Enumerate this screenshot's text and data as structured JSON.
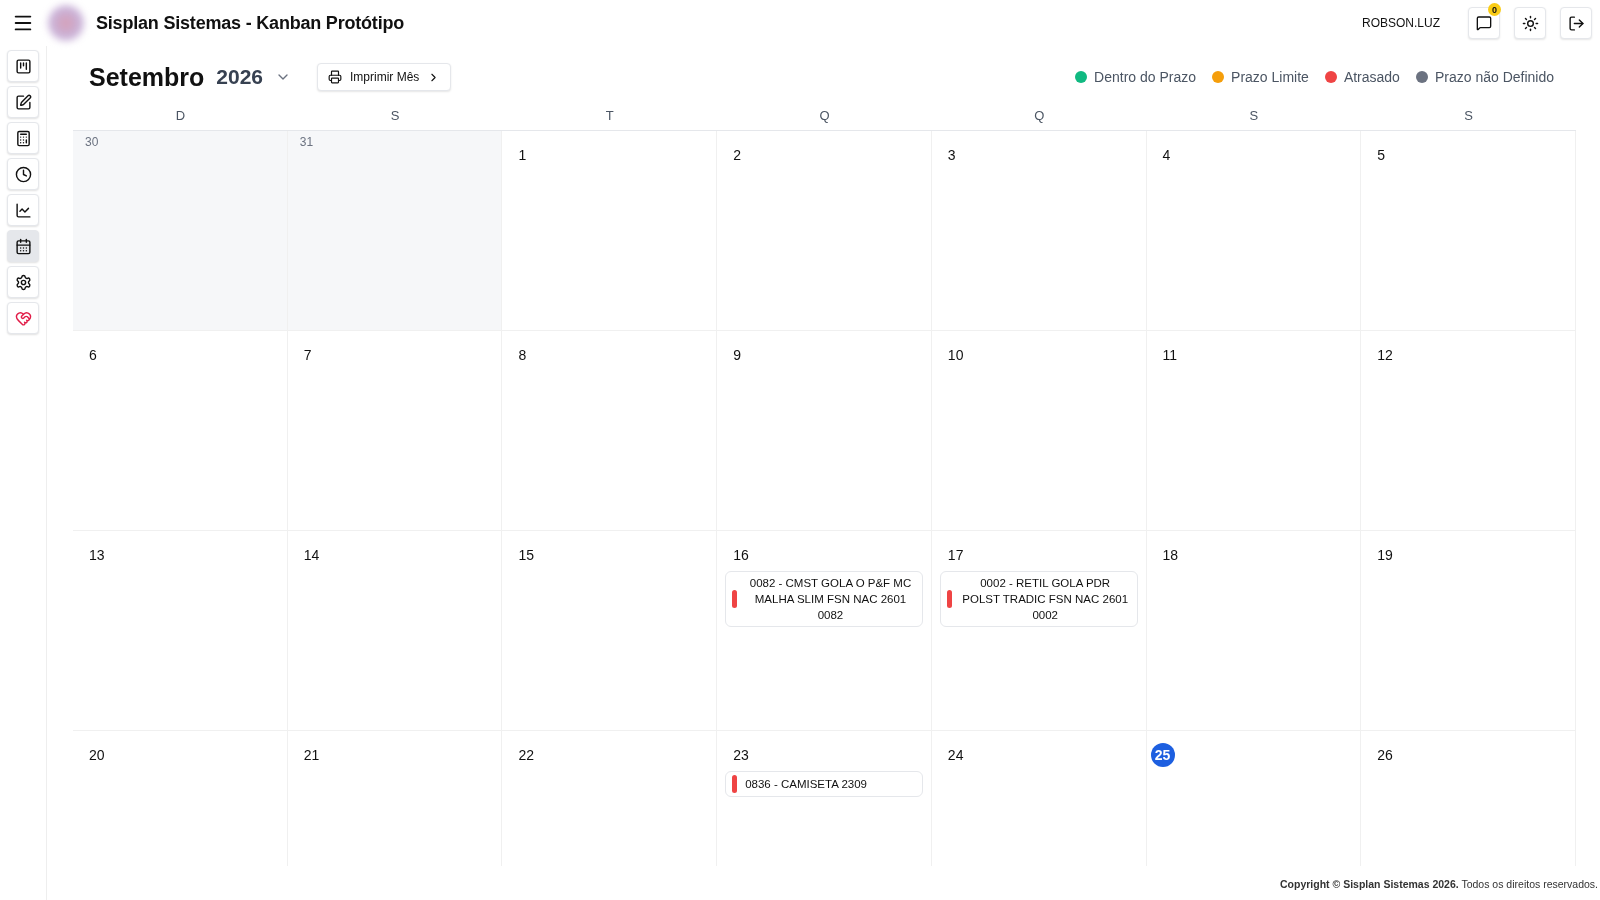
{
  "header": {
    "title": "Sisplan Sistemas - Kanban Protótipo",
    "user": "ROBSON.LUZ",
    "notification_count": "0"
  },
  "sidebar": {
    "items": [
      {
        "kind": "kanban",
        "selected": false
      },
      {
        "kind": "edit",
        "selected": false
      },
      {
        "kind": "calculator",
        "selected": false
      },
      {
        "kind": "clock",
        "selected": false
      },
      {
        "kind": "chart",
        "selected": false
      },
      {
        "kind": "calendar",
        "selected": true
      },
      {
        "kind": "gear",
        "selected": false
      },
      {
        "kind": "heart",
        "selected": false
      }
    ]
  },
  "calendar": {
    "month": "Setembro",
    "year": "2026",
    "print_button": "Imprimir Mês",
    "legend": [
      {
        "label": "Dentro do Prazo",
        "color": "#10b981"
      },
      {
        "label": "Prazo Limite",
        "color": "#f59e0b"
      },
      {
        "label": "Atrasado",
        "color": "#ef4444"
      },
      {
        "label": "Prazo não Definido",
        "color": "#6b7280"
      }
    ],
    "weekdays": [
      "D",
      "S",
      "T",
      "Q",
      "Q",
      "S",
      "S"
    ],
    "weeks": [
      [
        {
          "day": "30",
          "outside": true,
          "today": false
        },
        {
          "day": "31",
          "outside": true,
          "today": false
        },
        {
          "day": "1",
          "outside": false,
          "today": false
        },
        {
          "day": "2",
          "outside": false,
          "today": false
        },
        {
          "day": "3",
          "outside": false,
          "today": false
        },
        {
          "day": "4",
          "outside": false,
          "today": false
        },
        {
          "day": "5",
          "outside": false,
          "today": false
        }
      ],
      [
        {
          "day": "6",
          "outside": false,
          "today": false
        },
        {
          "day": "7",
          "outside": false,
          "today": false
        },
        {
          "day": "8",
          "outside": false,
          "today": false
        },
        {
          "day": "9",
          "outside": false,
          "today": false
        },
        {
          "day": "10",
          "outside": false,
          "today": false
        },
        {
          "day": "11",
          "outside": false,
          "today": false
        },
        {
          "day": "12",
          "outside": false,
          "today": false
        }
      ],
      [
        {
          "day": "13",
          "outside": false,
          "today": false
        },
        {
          "day": "14",
          "outside": false,
          "today": false
        },
        {
          "day": "15",
          "outside": false,
          "today": false
        },
        {
          "day": "16",
          "outside": false,
          "today": false,
          "events": [
            {
              "title": "0082 - CMST GOLA O P&F MC MALHA SLIM FSN NAC 2601 0082",
              "color": "#ef4444"
            }
          ]
        },
        {
          "day": "17",
          "outside": false,
          "today": false,
          "events": [
            {
              "title": "0002 - RETIL GOLA PDR POLST TRADIC FSN NAC 2601 0002",
              "color": "#ef4444"
            }
          ]
        },
        {
          "day": "18",
          "outside": false,
          "today": false
        },
        {
          "day": "19",
          "outside": false,
          "today": false
        }
      ],
      [
        {
          "day": "20",
          "outside": false,
          "today": false
        },
        {
          "day": "21",
          "outside": false,
          "today": false
        },
        {
          "day": "22",
          "outside": false,
          "today": false
        },
        {
          "day": "23",
          "outside": false,
          "today": false,
          "events": [
            {
              "title": "0836 - CAMISETA 2309",
              "color": "#ef4444"
            }
          ]
        },
        {
          "day": "24",
          "outside": false,
          "today": false
        },
        {
          "day": "25",
          "outside": false,
          "today": true
        },
        {
          "day": "26",
          "outside": false,
          "today": false
        }
      ]
    ]
  },
  "footer": {
    "text": "**Copyright © Sisplan Sistemas 2026.** Todos os direitos reservados."
  }
}
